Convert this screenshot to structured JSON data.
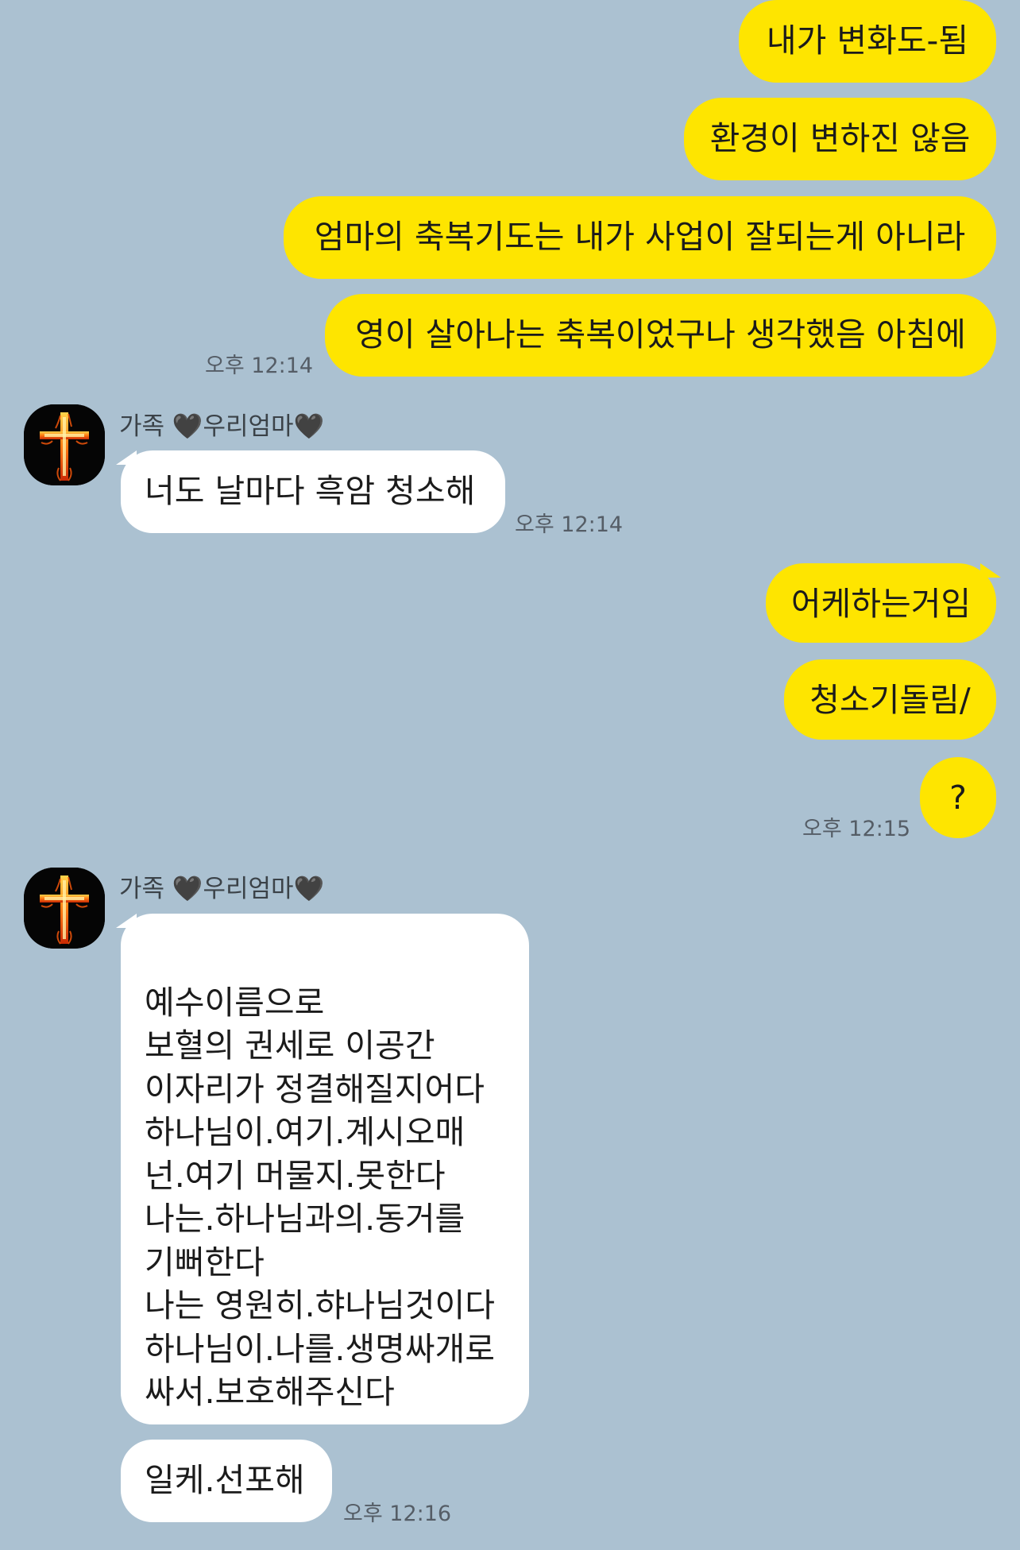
{
  "messages": {
    "m1": "내가 변화도-됨",
    "m2": "환경이 변하진 않음",
    "m3": "엄마의 축복기도는 내가 사업이 잘되는게 아니라",
    "m4": "영이 살아나는 축복이었구나 생각했음 아침에",
    "t1": "오후 12:14",
    "sender1": "가족 🖤우리엄마🖤",
    "r1": "너도 날마다 흑암 청소해",
    "t2": "오후 12:14",
    "m5": "어케하는거임",
    "m6": "청소기돌림/",
    "m7": "?",
    "t3": "오후 12:15",
    "sender2": "가족 🖤우리엄마🖤",
    "r2": "예수이름으로\n보혈의 권세로 이공간\n이자리가 정결해질지어다\n하나님이.여기.계시오매\n넌.여기 머물지.못한다\n나는.하나님과의.동거를\n기뻐한다\n나는 영원히.햐나님것이다\n하나님이.나를.생명싸개로\n싸서.보호해주신다",
    "r3": "일케.선포해",
    "t4": "오후 12:16"
  },
  "icons": {
    "avatar": "burning-cross-icon"
  },
  "colors": {
    "background": "#abc1d1",
    "my_bubble": "#fee500",
    "their_bubble": "#ffffff"
  }
}
